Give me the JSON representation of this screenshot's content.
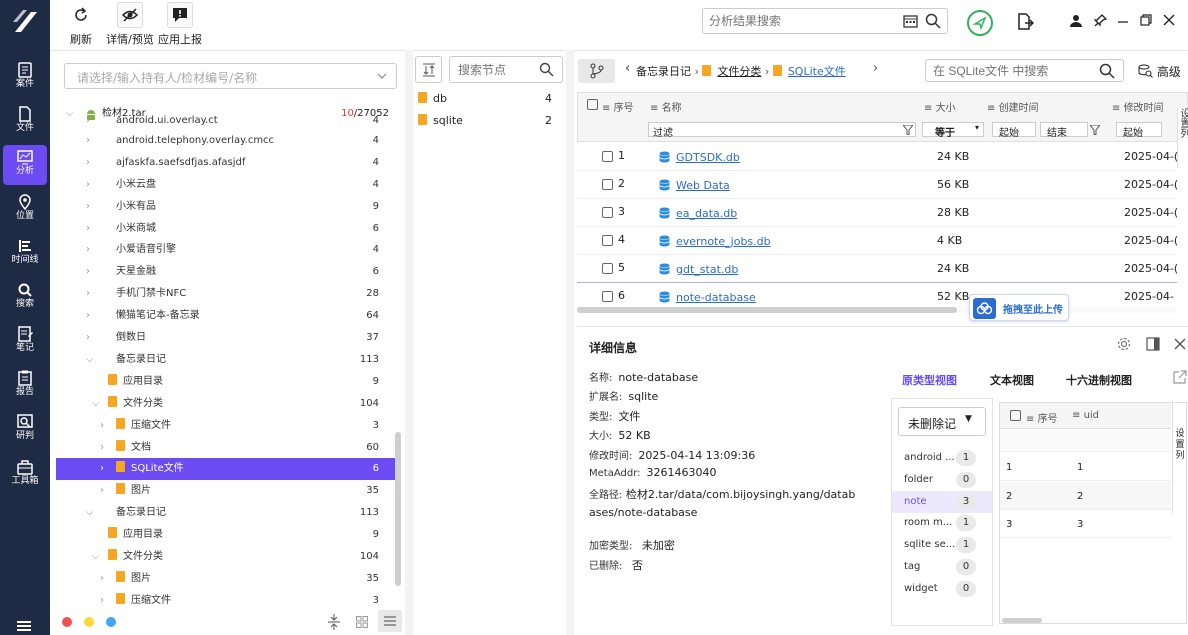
{
  "nav": {
    "items": [
      {
        "label": "案件",
        "icon": "case-icon"
      },
      {
        "label": "文件",
        "icon": "file-icon"
      },
      {
        "label": "分析",
        "icon": "analysis-icon",
        "active": true
      },
      {
        "label": "位置",
        "icon": "location-icon"
      },
      {
        "label": "时间线",
        "icon": "timeline-icon"
      },
      {
        "label": "搜索",
        "icon": "search-icon"
      },
      {
        "label": "笔记",
        "icon": "notes-icon"
      },
      {
        "label": "报告",
        "icon": "report-icon"
      },
      {
        "label": "研判",
        "icon": "judge-icon"
      },
      {
        "label": "工具箱",
        "icon": "toolbox-icon"
      }
    ]
  },
  "toolbar": {
    "refresh_label": "刷新",
    "detail_label": "详情/预览",
    "report_label": "应用上报",
    "search_placeholder": "分析结果搜索"
  },
  "source_filter": {
    "placeholder": "请选择/输入持有人/检材编号/名称"
  },
  "tree": {
    "root_label": "检材2.tar",
    "root_count_red": "10",
    "root_count_rest": "/27052",
    "rows": [
      {
        "label": "android.ui.overlay.ct",
        "count": "4"
      },
      {
        "label": "android.telephony.overlay.cmcc",
        "count": "4"
      },
      {
        "label": "ajfaskfa.saefsdfjas.afasjdf",
        "count": "4"
      },
      {
        "label": "小米云盘",
        "count": "4"
      },
      {
        "label": "小米有品",
        "count": "9"
      },
      {
        "label": "小米商城",
        "count": "6"
      },
      {
        "label": "小爱语音引擎",
        "count": "4"
      },
      {
        "label": "天星金融",
        "count": "6"
      },
      {
        "label": "手机门禁卡NFC",
        "count": "28"
      },
      {
        "label": "懒猫笔记本-备忘录",
        "count": "64"
      },
      {
        "label": "倒数日",
        "count": "37"
      },
      {
        "label": "备忘录日记",
        "count": "113"
      },
      {
        "label": "应用目录",
        "count": "9"
      },
      {
        "label": "文件分类",
        "count": "104"
      },
      {
        "label": "压缩文件",
        "count": "3"
      },
      {
        "label": "文档",
        "count": "60"
      },
      {
        "label": "SQLite文件",
        "count": "6"
      },
      {
        "label": "图片",
        "count": "35"
      },
      {
        "label": "备忘录日记",
        "count": "113"
      },
      {
        "label": "应用目录",
        "count": "9"
      },
      {
        "label": "文件分类",
        "count": "104"
      },
      {
        "label": "图片",
        "count": "35"
      },
      {
        "label": "压缩文件",
        "count": "3"
      }
    ]
  },
  "nodes": {
    "search_placeholder": "搜索节点",
    "items": [
      {
        "label": "db",
        "count": "4"
      },
      {
        "label": "sqlite",
        "count": "2"
      }
    ]
  },
  "breadcrumb": {
    "items": [
      "备忘录日记",
      "文件分类",
      "SQLite文件"
    ]
  },
  "file_search": {
    "placeholder": "在 SQLite文件 中搜索",
    "advanced_label": "高级"
  },
  "grid": {
    "headers": {
      "seq": "序号",
      "name": "名称",
      "size": "大小",
      "created": "创建时间",
      "modified": "修改时间"
    },
    "filter": {
      "label": "过滤",
      "op": "等于",
      "start": "起始",
      "end": "结束",
      "start2": "起始"
    },
    "rows": [
      {
        "seq": "1",
        "name": "GDTSDK.db",
        "size": "24 KB",
        "modified": "2025-04-("
      },
      {
        "seq": "2",
        "name": "Web Data",
        "size": "56 KB",
        "modified": "2025-04-("
      },
      {
        "seq": "3",
        "name": "ea_data.db",
        "size": "28 KB",
        "modified": "2025-04-("
      },
      {
        "seq": "4",
        "name": "evernote_jobs.db",
        "size": "4 KB",
        "modified": "2025-04-("
      },
      {
        "seq": "5",
        "name": "gdt_stat.db",
        "size": "24 KB",
        "modified": "2025-04-("
      },
      {
        "seq": "6",
        "name": "note-database",
        "size": "52 KB",
        "modified": "2025-04-"
      }
    ],
    "upload_label": "拖拽至此上传",
    "side_label": "设置列"
  },
  "detail": {
    "title": "详细信息",
    "fields": [
      {
        "k": "名称:",
        "v": "note-database"
      },
      {
        "k": "扩展名:",
        "v": "sqlite"
      },
      {
        "k": "类型:",
        "v": "文件"
      },
      {
        "k": "大小:",
        "v": "52 KB"
      },
      {
        "k": "修改时间:",
        "v": "2025-04-14 13:09:36"
      },
      {
        "k": "MetaAddr:",
        "v": "3261463040"
      }
    ],
    "path_key": "全路径:",
    "path_value": "检材2.tar/data/com.bijoysingh.yang/databases/note-database",
    "enc_key": "加密类型:",
    "enc_value": "未加密",
    "del_key": "已删除:",
    "del_value": "否"
  },
  "viewer": {
    "tabs": [
      "原类型视图",
      "文本视图",
      "十六进制视图"
    ],
    "filter_value": "未删除记",
    "tables": [
      {
        "name": "android ...",
        "count": "1"
      },
      {
        "name": "folder",
        "count": "0"
      },
      {
        "name": "note",
        "count": "3"
      },
      {
        "name": "room m...",
        "count": "1"
      },
      {
        "name": "sqlite se...",
        "count": "1"
      },
      {
        "name": "tag",
        "count": "0"
      },
      {
        "name": "widget",
        "count": "0"
      }
    ],
    "headers": {
      "seq": "序号",
      "uid": "uid"
    },
    "rows": [
      {
        "seq": "1",
        "uid": "1"
      },
      {
        "seq": "2",
        "uid": "2"
      },
      {
        "seq": "3",
        "uid": "3"
      }
    ],
    "side_label": "设置列"
  },
  "colors": {
    "accent": "#6a4cf2",
    "nav_bg": "#1f2a44",
    "folder": "#f5a623",
    "link": "#2b6ccf"
  }
}
